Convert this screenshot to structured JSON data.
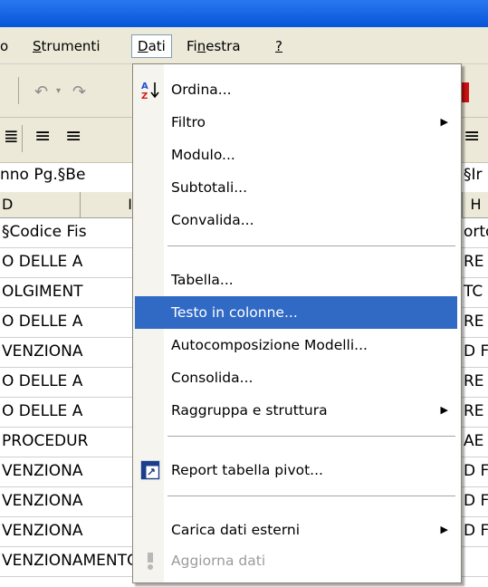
{
  "menubar": {
    "items": [
      {
        "label": "o",
        "ul": ""
      },
      {
        "label": "Strumenti",
        "ul": "S"
      },
      {
        "label": "Dati",
        "ul": "D"
      },
      {
        "label": "Finestra",
        "ul": "n"
      },
      {
        "label": "?",
        "ul": "?"
      }
    ]
  },
  "formula_text": "nno Pg.§Be",
  "formula_text_right": "§Ir",
  "columns": {
    "d": "D",
    "e": "I",
    "h": "H"
  },
  "grid": {
    "left_cells": [
      "§Codice Fis",
      "O DELLE A",
      "OLGIMENT",
      "O DELLE A",
      "VENZIONA",
      "O DELLE A",
      "O DELLE A",
      "PROCEDUR",
      "VENZIONA",
      "VENZIONA",
      "VENZIONA",
      "VENZIONAMENTO DI CASE DI RIPOSO F"
    ],
    "right_cells": [
      "orto",
      "RE",
      "TC",
      "RE",
      "D F",
      "RE",
      "RE",
      "AE",
      "D F",
      "D F",
      "D F",
      ""
    ]
  },
  "dati_menu": {
    "items": [
      {
        "label": "Ordina...",
        "icon": "sort-ascending-icon",
        "enabled": true,
        "submenu": false
      },
      {
        "label": "Filtro",
        "enabled": true,
        "submenu": true
      },
      {
        "label": "Modulo...",
        "enabled": true,
        "submenu": false
      },
      {
        "label": "Subtotali...",
        "enabled": true,
        "submenu": false
      },
      {
        "label": "Convalida...",
        "enabled": true,
        "submenu": false
      },
      {
        "label": "Tabella...",
        "enabled": true,
        "submenu": false
      },
      {
        "label": "Testo in colonne...",
        "enabled": true,
        "submenu": false,
        "selected": true
      },
      {
        "label": "Autocomposizione Modelli...",
        "enabled": true,
        "submenu": false
      },
      {
        "label": "Consolida...",
        "enabled": true,
        "submenu": false
      },
      {
        "label": "Raggruppa e struttura",
        "enabled": true,
        "submenu": true
      },
      {
        "label": "Report tabella pivot...",
        "icon": "pivot-table-icon",
        "enabled": true,
        "submenu": false
      },
      {
        "label": "Carica dati esterni",
        "enabled": true,
        "submenu": true
      },
      {
        "label": "Aggiorna dati",
        "icon": "refresh-data-icon",
        "enabled": false,
        "submenu": false
      }
    ]
  },
  "colors": {
    "selection": "#316ac5",
    "menubar": "#ece9d8",
    "titlebar": "#0754d8"
  }
}
